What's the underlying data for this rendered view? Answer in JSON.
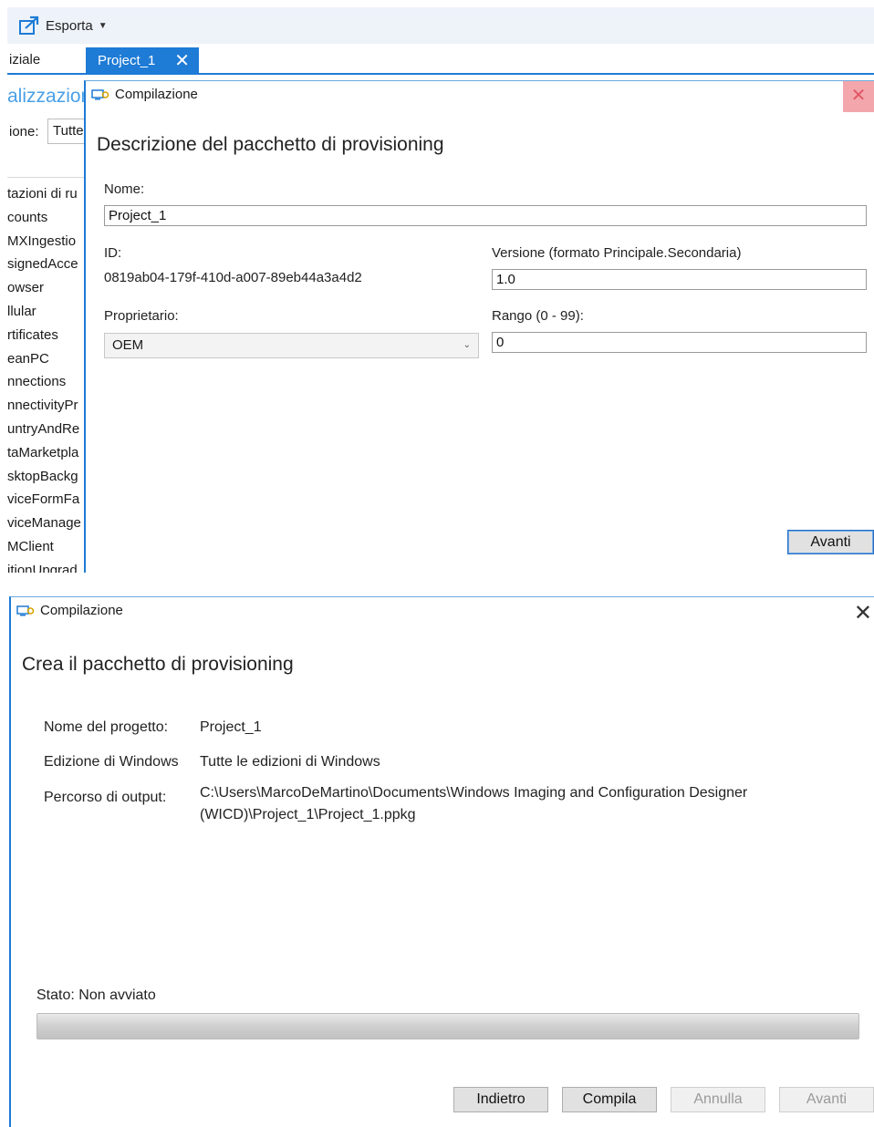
{
  "toolbar": {
    "export_label": "Esporta"
  },
  "tabs": {
    "home_label": "iziale",
    "project_label": "Project_1"
  },
  "left_pane": {
    "heading": "alizzazion",
    "filter_label": "ione:",
    "filter_value": "Tutte",
    "items": [
      "tazioni di ru",
      "counts",
      "MXIngestio",
      "signedAcce",
      "owser",
      "llular",
      "rtificates",
      "eanPC",
      "nnections",
      "nnectivityPr",
      "untryAndRe",
      "taMarketpla",
      "sktopBackg",
      "viceFormFa",
      "viceManage",
      "MClient",
      "itionUpgrad"
    ]
  },
  "dialog1": {
    "title": "Compilazione",
    "heading": "Descrizione del pacchetto di provisioning",
    "name_label": "Nome:",
    "name_value": "Project_1",
    "id_label": "ID:",
    "id_value": "0819ab04-179f-410d-a007-89eb44a3a4d2",
    "version_label": "Versione (formato Principale.Secondaria)",
    "version_value": "1.0",
    "owner_label": "Proprietario:",
    "owner_value": "OEM",
    "rank_label": "Rango (0 - 99):",
    "rank_value": "0",
    "next_label": "Avanti"
  },
  "dialog2": {
    "title": "Compilazione",
    "heading": "Crea il pacchetto di provisioning",
    "project_name_label": "Nome del progetto:",
    "project_name_value": "Project_1",
    "edition_label": "Edizione di Windows",
    "edition_value": "Tutte le edizioni di Windows",
    "output_label": "Percorso di output:",
    "output_value": "C:\\Users\\MarcoDeMartino\\Documents\\Windows Imaging and Configuration Designer (WICD)\\Project_1\\Project_1.ppkg",
    "status_label": "Stato:",
    "status_value": "Non avviato",
    "progress_percent": 0,
    "buttons": {
      "back": "Indietro",
      "build": "Compila",
      "cancel": "Annulla",
      "next": "Avanti"
    }
  },
  "colors": {
    "accent": "#1e7bd6",
    "progress_fill": "#06b025"
  },
  "icons": {
    "export": "export-icon",
    "build": "build-icon",
    "close": "close-icon",
    "dropdown": "chevron-down-icon"
  }
}
